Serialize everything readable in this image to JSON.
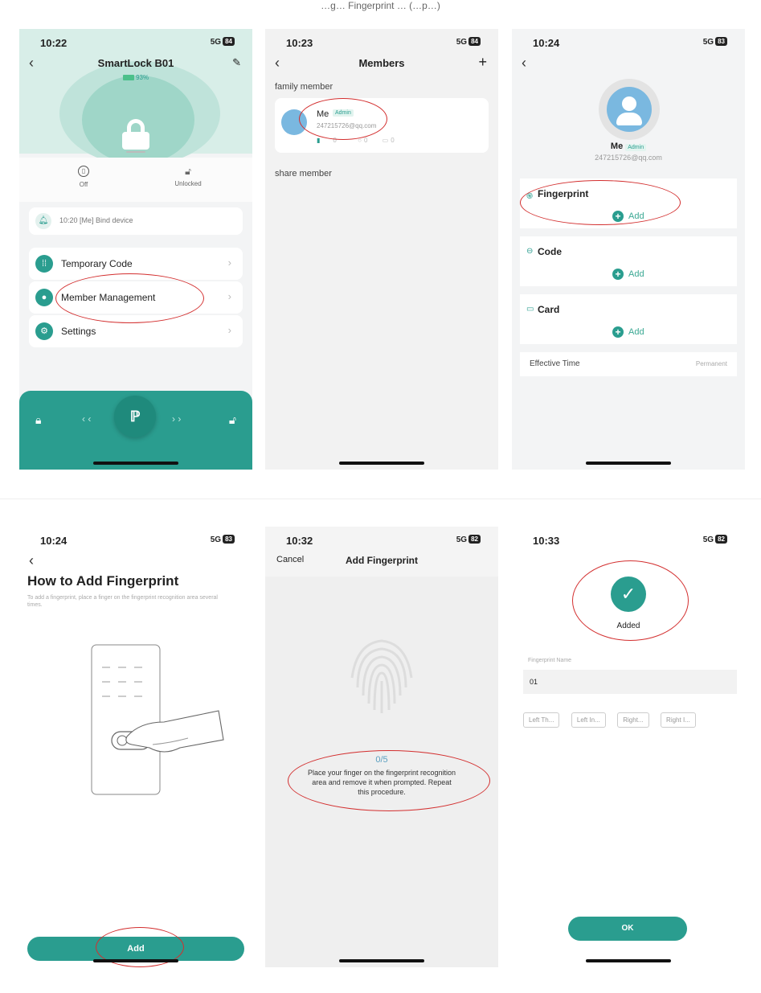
{
  "caption": "…g… Fingerprint … (…p…)",
  "screen1": {
    "time": "10:22",
    "signal": "5G",
    "battery_level": "84",
    "title": "SmartLock B01",
    "battery_pct": "93%",
    "stat_left": "Off",
    "stat_right": "Unlocked",
    "log": "10:20 [Me] Bind device",
    "menu": [
      {
        "label": "Temporary Code",
        "icon": "grid-icon"
      },
      {
        "label": "Member Management",
        "icon": "person-icon"
      },
      {
        "label": "Settings",
        "icon": "gear-icon"
      }
    ]
  },
  "screen2": {
    "time": "10:23",
    "signal": "5G",
    "battery_level": "84",
    "title": "Members",
    "section_family": "family member",
    "member_name": "Me",
    "member_badge": "Admin",
    "member_email": "247215726@qq.com",
    "count_fp": "0",
    "count_code": "0",
    "count_card": "0",
    "section_share": "share member"
  },
  "screen3": {
    "time": "10:24",
    "signal": "5G",
    "battery_level": "83",
    "name": "Me",
    "badge": "Admin",
    "email": "247215726@qq.com",
    "fingerprint": "Fingerprint",
    "code": "Code",
    "card": "Card",
    "add": "Add",
    "effective_label": "Effective Time",
    "effective_value": "Permanent"
  },
  "screen4": {
    "time": "10:24",
    "signal": "5G",
    "battery_level": "83",
    "heading": "How to Add Fingerprint",
    "desc": "To add a fingerprint, place a finger on the fingerprint recognition area several times.",
    "button": "Add"
  },
  "screen5": {
    "time": "10:32",
    "signal": "5G",
    "battery_level": "82",
    "cancel": "Cancel",
    "title": "Add Fingerprint",
    "progress": "0/5",
    "instruction": "Place your finger on the fingerprint recognition area and remove it when prompted. Repeat this procedure."
  },
  "screen6": {
    "time": "10:33",
    "signal": "5G",
    "battery_level": "82",
    "status": "Added",
    "name_label": "Fingerprint Name",
    "name_value": "01",
    "chips": [
      "Left Th...",
      "Left In...",
      "Right...",
      "Right I..."
    ],
    "ok": "OK"
  },
  "colors": {
    "accent": "#2a9d8f",
    "annotation": "#d32f2f"
  }
}
